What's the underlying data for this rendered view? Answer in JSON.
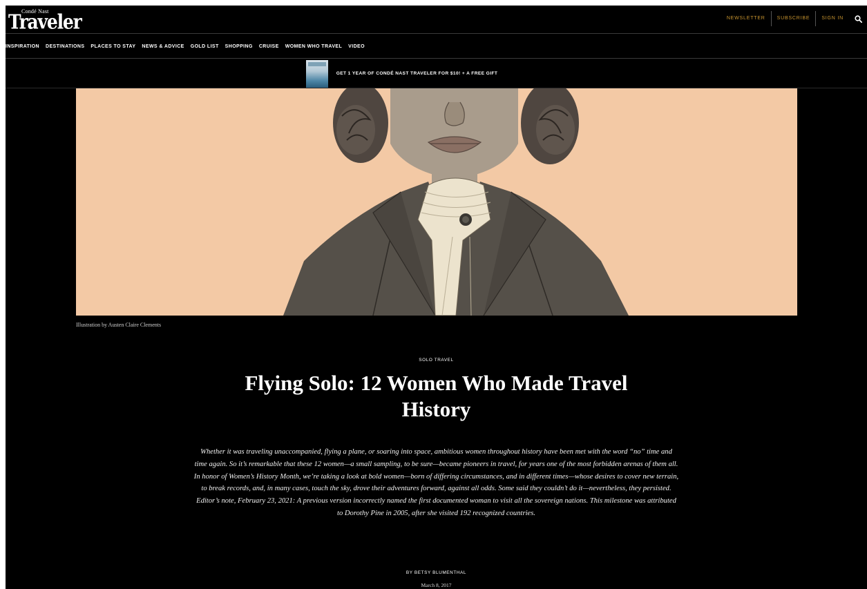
{
  "brand": {
    "small": "Condé Nast",
    "name": "Traveler"
  },
  "util_nav": {
    "newsletter": "NEWSLETTER",
    "subscribe": "SUBSCRIBE",
    "sign_in": "SIGN IN"
  },
  "nav": [
    "INSPIRATION",
    "DESTINATIONS",
    "PLACES TO STAY",
    "NEWS & ADVICE",
    "GOLD LIST",
    "SHOPPING",
    "CRUISE",
    "WOMEN WHO TRAVEL",
    "VIDEO"
  ],
  "promo": {
    "text": "GET 1 YEAR OF CONDÉ NAST TRAVELER FOR $10! + A FREE GIFT"
  },
  "hero": {
    "caption": "Illustration by Austen Claire Clements"
  },
  "article": {
    "rubric": "SOLO TRAVEL",
    "headline": "Flying Solo: 12 Women Who Made Travel History",
    "dek": "Whether it was traveling unaccompanied, flying a plane, or soaring into space, ambitious women throughout history have been met with the word “no” time and time again. So it’s remarkable that these 12 women—a small sampling, to be sure—became pioneers in travel, for years one of the most forbidden arenas of them all. In honor of Women’s History Month, we’re taking a look at bold women—born of differing circumstances, and in different times—whose desires to cover new terrain, to break records, and, in many cases, touch the sky, drove their adventures forward, against all odds. Some said they couldn’t do it—nevertheless, they persisted. Editor’s note, February 23, 2021: A previous version incorrectly named the first documented woman to visit all the sovereign nations. This milestone was attributed to Dorothy Pine in 2005, after she visited 192 recognized countries.",
    "byline": "BY BETSY BLUMENTHAL",
    "date": "March 8, 2017"
  },
  "colors": {
    "accent": "#c9952f",
    "background": "#000000",
    "hero_bg": "#f3c9a5"
  },
  "icons": {
    "search": "search-icon"
  }
}
